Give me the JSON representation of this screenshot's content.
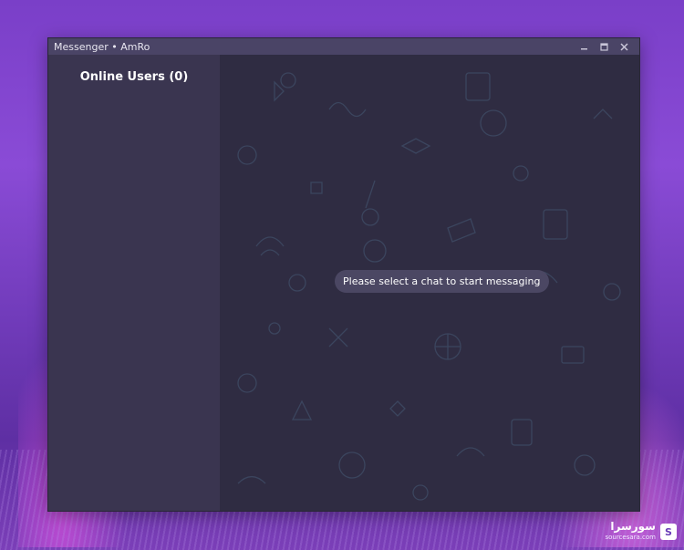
{
  "window": {
    "title": "Messenger • AmRo",
    "controls": [
      "minimize-icon",
      "maximize-icon",
      "close-icon"
    ]
  },
  "sidebar": {
    "heading": "Online Users (0)"
  },
  "chat": {
    "placeholder_message": "Please select a chat to start messaging"
  },
  "watermark": {
    "text": "سورسرا",
    "subtext": "sourcesara.com"
  },
  "colors": {
    "sidebar_bg": "#3a3550",
    "chat_bg": "#2f2c42",
    "titlebar_bg": "#4a4466",
    "bubble_bg": "#4b4763"
  }
}
